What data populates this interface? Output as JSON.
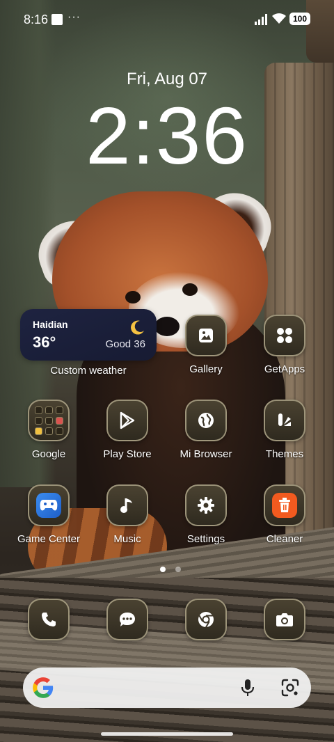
{
  "status_bar": {
    "time": "8:16",
    "dots": "···",
    "battery": "100"
  },
  "lockscreen": {
    "date": "Fri, Aug 07",
    "time": "2:36"
  },
  "weather_widget": {
    "city": "Haidian",
    "temperature": "36°",
    "air_quality": "Good 36",
    "label": "Custom weather"
  },
  "apps_row1": [
    {
      "label": "Gallery"
    },
    {
      "label": "GetApps"
    }
  ],
  "apps_row2": [
    {
      "label": "Google"
    },
    {
      "label": "Play Store"
    },
    {
      "label": "Mi Browser"
    },
    {
      "label": "Themes"
    }
  ],
  "apps_row3": [
    {
      "label": "Game Center"
    },
    {
      "label": "Music"
    },
    {
      "label": "Settings"
    },
    {
      "label": "Cleaner"
    }
  ],
  "dock": [
    {
      "icon": "phone-icon"
    },
    {
      "icon": "messages-icon"
    },
    {
      "icon": "chrome-icon"
    },
    {
      "icon": "camera-icon"
    }
  ],
  "pager": {
    "pages": 2,
    "current": 1
  },
  "colors": {
    "icon_bg": "#3d3628",
    "icon_border": "#beb496",
    "weather_bg": "#1c2140",
    "cleaner_accent": "#f25a1f",
    "game_accent": "#2a7be4"
  }
}
